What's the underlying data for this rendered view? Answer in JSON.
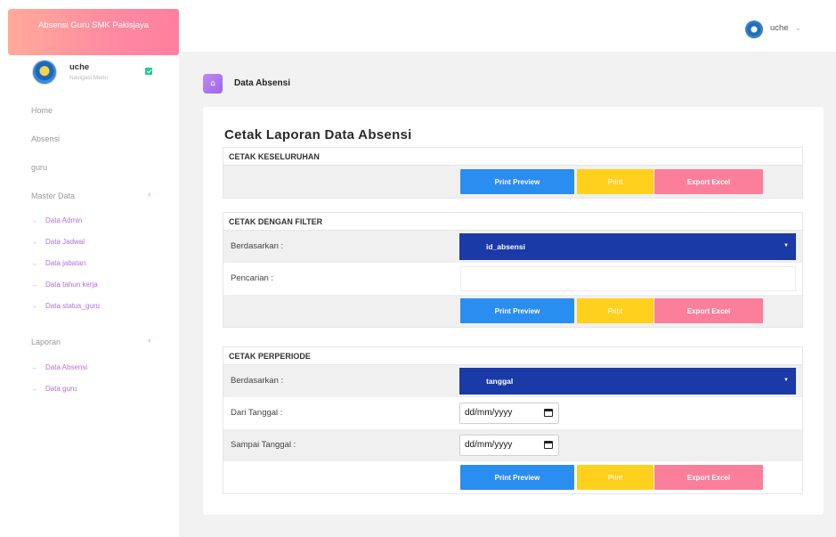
{
  "app": {
    "brand": "Absensi Guru SMK Pakisjaya"
  },
  "user": {
    "name": "uche",
    "role": "Navigasi Menu"
  },
  "topbar": {
    "username": "uche",
    "caret": "⌄"
  },
  "nav": {
    "home": "Home",
    "absensi": "Absensi",
    "guru": "guru",
    "master_data": "Master Data",
    "master_items": [
      "Data Admin",
      "Data Jadwal",
      "Data jabatan",
      "Data tahun kerja",
      "Data status_guru"
    ],
    "laporan": "Laporan",
    "laporan_items": [
      "Data Absensi",
      "Data guru"
    ],
    "caret": "‹",
    "arrow": "→"
  },
  "page": {
    "header_title": "Data Absensi",
    "card_title": "Cetak Laporan Data Absensi"
  },
  "buttons": {
    "preview": "Print Preview",
    "print": "Print",
    "excel": "Export Excel"
  },
  "sections": {
    "all": {
      "title": "CETAK KESELURUHAN"
    },
    "filter": {
      "title": "CETAK DENGAN FILTER",
      "by_label": "Berdasarkan :",
      "by_value": "id_absensi",
      "search_label": "Pencarian :",
      "search_value": ""
    },
    "period": {
      "title": "CETAK PERPERIODE",
      "by_label": "Berdasarkan :",
      "by_value": "tanggal",
      "from_label": "Dari Tanggal :",
      "from_value": "dd/mm/yyyy",
      "to_label": "Sampai Tanggal :",
      "to_value": "dd/mm/yyyy"
    }
  },
  "colors": {
    "brand_gradient_start": "#ffab9a",
    "brand_gradient_end": "#ff7f9e",
    "preview": "#2a8df0",
    "print": "#ffd11d",
    "excel": "#fb7f9a",
    "select": "#1a3aa8"
  }
}
